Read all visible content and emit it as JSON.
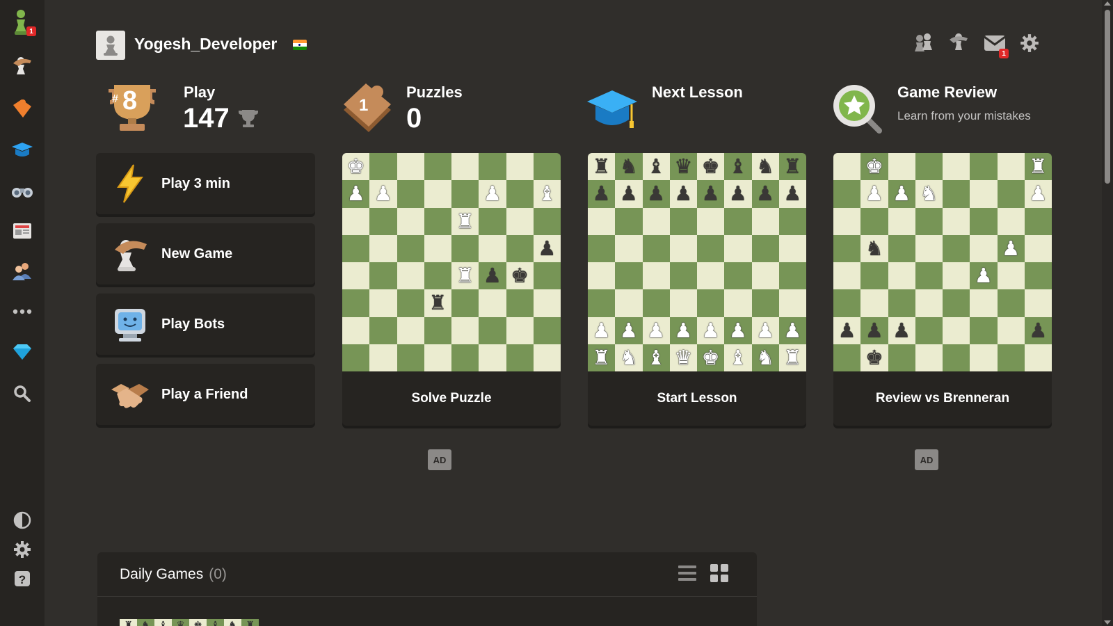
{
  "nav": {
    "play_badge": "1",
    "items": [
      "play-icon",
      "puzzles-icon",
      "learn-icon",
      "lessons-icon",
      "watch-icon",
      "news-icon",
      "social-icon",
      "more-icon",
      "premium-icon",
      "search-icon"
    ],
    "bottom": [
      "theme-toggle-icon",
      "settings-icon",
      "help-icon"
    ]
  },
  "header": {
    "username": "Yogesh_Developer",
    "messages_badge": "1"
  },
  "play": {
    "title": "Play",
    "rank_badge": "8",
    "rank_prefix": "#",
    "rating": "147",
    "buttons": [
      {
        "label": "Play 3 min",
        "icon": "lightning-icon"
      },
      {
        "label": "New Game",
        "icon": "pawn-hand-icon"
      },
      {
        "label": "Play Bots",
        "icon": "bot-icon"
      },
      {
        "label": "Play a Friend",
        "icon": "handshake-icon"
      }
    ]
  },
  "puzzles": {
    "title": "Puzzles",
    "value": "0",
    "icon_number": "1",
    "button": "Solve Puzzle",
    "board": [
      "K.......",
      "PP...P.B",
      "....R...",
      ".......p",
      "....Rpk.",
      "...r....",
      "........",
      "........"
    ]
  },
  "lesson": {
    "title": "Next Lesson",
    "button": "Start Lesson",
    "board": [
      "rnbqkbnr",
      "pppppppp",
      "........",
      "........",
      "........",
      "........",
      "PPPPPPPP",
      "RNBQKBNR"
    ]
  },
  "review": {
    "title": "Game Review",
    "subtitle": "Learn from your mistakes",
    "button": "Review vs Brenneran",
    "board": [
      ".K.....R",
      ".PPN...P",
      "........",
      ".n....P.",
      ".....P..",
      "........",
      "ppp....p",
      ".k......"
    ]
  },
  "ads": [
    "AD",
    "AD"
  ],
  "daily": {
    "title": "Daily Games",
    "count": "(0)"
  },
  "colors": {
    "light_square": "#ebecd0",
    "dark_square": "#779556",
    "background": "#302e2b",
    "panel": "#262421"
  }
}
